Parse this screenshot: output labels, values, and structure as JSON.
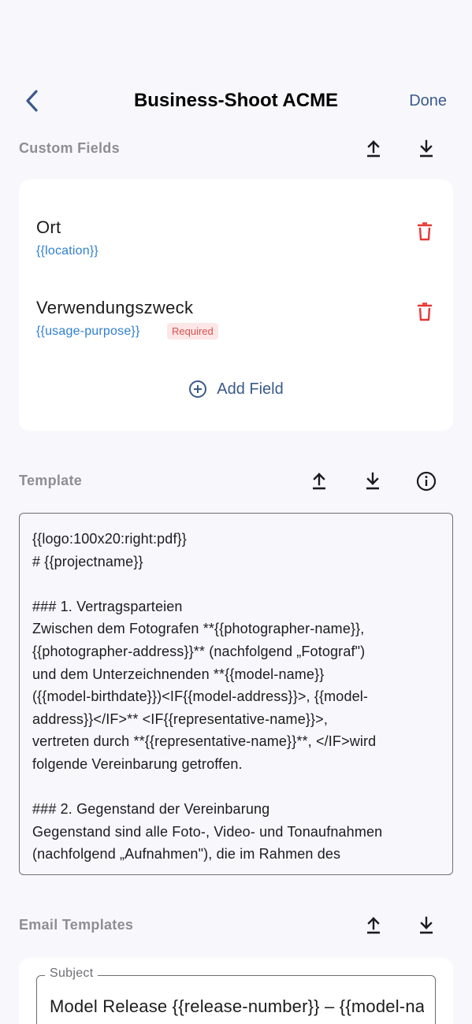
{
  "nav": {
    "title": "Business-Shoot ACME",
    "done_label": "Done"
  },
  "custom_fields": {
    "label": "Custom Fields",
    "fields": [
      {
        "name": "Ort",
        "key": "{{location}}",
        "required": false
      },
      {
        "name": "Verwendungszweck",
        "key": "{{usage-purpose}}",
        "required": true,
        "required_label": "Required"
      }
    ],
    "add_label": "Add Field"
  },
  "template": {
    "label": "Template",
    "content": "{{logo:100x20:right:pdf}}\n# {{projectname}}\n\n### 1. Vertragsparteien\nZwischen dem Fotografen **{{photographer-name}},\n{{photographer-address}}** (nachfolgend „Fotograf\")\nund dem Unterzeichnenden **{{model-name}}\n({{model-birthdate}})<IF{{model-address}}>, {{model-\naddress}}</IF>** <IF{{representative-name}}>,\nvertreten durch **{{representative-name}}**, </IF>wird\nfolgende Vereinbarung getroffen.\n\n### 2. Gegenstand der Vereinbarung\nGegenstand sind alle Foto-, Video- und Tonaufnahmen\n(nachfolgend „Aufnahmen\"), die im Rahmen des"
  },
  "email_templates": {
    "label": "Email Templates",
    "subject_label": "Subject",
    "subject_value": "Model Release {{release-number}} – {{model-name}}"
  },
  "icons": {
    "back": "chevron-left-icon",
    "upload": "upload-icon",
    "download": "download-icon",
    "info": "info-icon",
    "trash": "trash-icon",
    "add": "add-circle-icon"
  },
  "colors": {
    "accent": "#3a5a8c",
    "link": "#2f7fd1",
    "danger": "#e53935",
    "background": "#f8f8fc"
  }
}
